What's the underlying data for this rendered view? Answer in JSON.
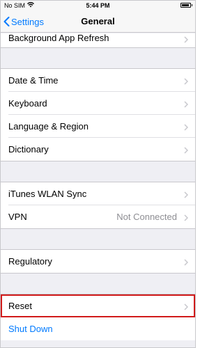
{
  "status_bar": {
    "carrier": "No SIM",
    "time": "5:44 PM",
    "battery_level": 0.9,
    "icons": [
      "wifi-icon",
      "battery-icon"
    ]
  },
  "nav": {
    "back_label": "Settings",
    "title": "General"
  },
  "groups": {
    "g0": [
      "Background App Refresh"
    ],
    "g1": [
      "Date & Time",
      "Keyboard",
      "Language & Region",
      "Dictionary"
    ],
    "g2": [
      "iTunes WLAN Sync",
      "VPN"
    ],
    "g3": [
      "Regulatory"
    ],
    "g4": [
      "Reset",
      "Shut Down"
    ]
  },
  "vpn_value": "Not Connected",
  "colors": {
    "accent": "#007aff",
    "highlight": "#d11a1a",
    "secondary_text": "#8e8e93"
  }
}
